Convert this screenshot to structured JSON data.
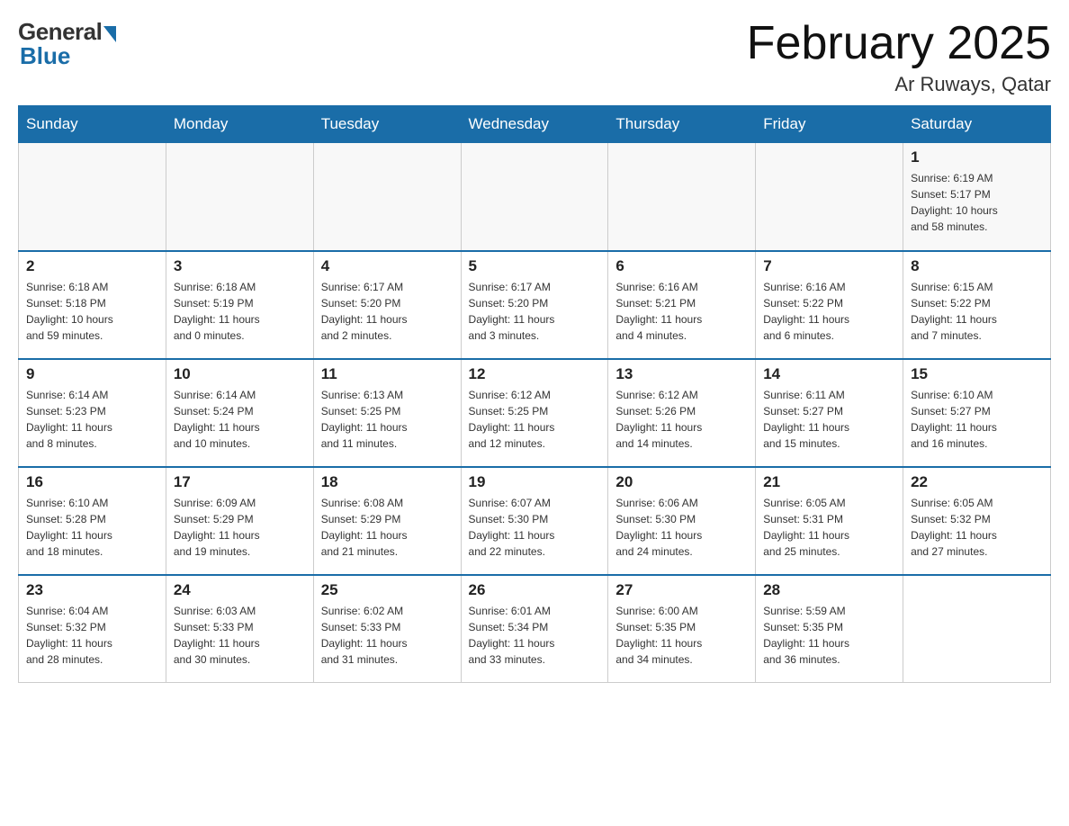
{
  "logo": {
    "general": "General",
    "blue": "Blue"
  },
  "title": "February 2025",
  "location": "Ar Ruways, Qatar",
  "days_of_week": [
    "Sunday",
    "Monday",
    "Tuesday",
    "Wednesday",
    "Thursday",
    "Friday",
    "Saturday"
  ],
  "weeks": [
    {
      "days": [
        {
          "number": "",
          "info": ""
        },
        {
          "number": "",
          "info": ""
        },
        {
          "number": "",
          "info": ""
        },
        {
          "number": "",
          "info": ""
        },
        {
          "number": "",
          "info": ""
        },
        {
          "number": "",
          "info": ""
        },
        {
          "number": "1",
          "info": "Sunrise: 6:19 AM\nSunset: 5:17 PM\nDaylight: 10 hours\nand 58 minutes."
        }
      ]
    },
    {
      "days": [
        {
          "number": "2",
          "info": "Sunrise: 6:18 AM\nSunset: 5:18 PM\nDaylight: 10 hours\nand 59 minutes."
        },
        {
          "number": "3",
          "info": "Sunrise: 6:18 AM\nSunset: 5:19 PM\nDaylight: 11 hours\nand 0 minutes."
        },
        {
          "number": "4",
          "info": "Sunrise: 6:17 AM\nSunset: 5:20 PM\nDaylight: 11 hours\nand 2 minutes."
        },
        {
          "number": "5",
          "info": "Sunrise: 6:17 AM\nSunset: 5:20 PM\nDaylight: 11 hours\nand 3 minutes."
        },
        {
          "number": "6",
          "info": "Sunrise: 6:16 AM\nSunset: 5:21 PM\nDaylight: 11 hours\nand 4 minutes."
        },
        {
          "number": "7",
          "info": "Sunrise: 6:16 AM\nSunset: 5:22 PM\nDaylight: 11 hours\nand 6 minutes."
        },
        {
          "number": "8",
          "info": "Sunrise: 6:15 AM\nSunset: 5:22 PM\nDaylight: 11 hours\nand 7 minutes."
        }
      ]
    },
    {
      "days": [
        {
          "number": "9",
          "info": "Sunrise: 6:14 AM\nSunset: 5:23 PM\nDaylight: 11 hours\nand 8 minutes."
        },
        {
          "number": "10",
          "info": "Sunrise: 6:14 AM\nSunset: 5:24 PM\nDaylight: 11 hours\nand 10 minutes."
        },
        {
          "number": "11",
          "info": "Sunrise: 6:13 AM\nSunset: 5:25 PM\nDaylight: 11 hours\nand 11 minutes."
        },
        {
          "number": "12",
          "info": "Sunrise: 6:12 AM\nSunset: 5:25 PM\nDaylight: 11 hours\nand 12 minutes."
        },
        {
          "number": "13",
          "info": "Sunrise: 6:12 AM\nSunset: 5:26 PM\nDaylight: 11 hours\nand 14 minutes."
        },
        {
          "number": "14",
          "info": "Sunrise: 6:11 AM\nSunset: 5:27 PM\nDaylight: 11 hours\nand 15 minutes."
        },
        {
          "number": "15",
          "info": "Sunrise: 6:10 AM\nSunset: 5:27 PM\nDaylight: 11 hours\nand 16 minutes."
        }
      ]
    },
    {
      "days": [
        {
          "number": "16",
          "info": "Sunrise: 6:10 AM\nSunset: 5:28 PM\nDaylight: 11 hours\nand 18 minutes."
        },
        {
          "number": "17",
          "info": "Sunrise: 6:09 AM\nSunset: 5:29 PM\nDaylight: 11 hours\nand 19 minutes."
        },
        {
          "number": "18",
          "info": "Sunrise: 6:08 AM\nSunset: 5:29 PM\nDaylight: 11 hours\nand 21 minutes."
        },
        {
          "number": "19",
          "info": "Sunrise: 6:07 AM\nSunset: 5:30 PM\nDaylight: 11 hours\nand 22 minutes."
        },
        {
          "number": "20",
          "info": "Sunrise: 6:06 AM\nSunset: 5:30 PM\nDaylight: 11 hours\nand 24 minutes."
        },
        {
          "number": "21",
          "info": "Sunrise: 6:05 AM\nSunset: 5:31 PM\nDaylight: 11 hours\nand 25 minutes."
        },
        {
          "number": "22",
          "info": "Sunrise: 6:05 AM\nSunset: 5:32 PM\nDaylight: 11 hours\nand 27 minutes."
        }
      ]
    },
    {
      "days": [
        {
          "number": "23",
          "info": "Sunrise: 6:04 AM\nSunset: 5:32 PM\nDaylight: 11 hours\nand 28 minutes."
        },
        {
          "number": "24",
          "info": "Sunrise: 6:03 AM\nSunset: 5:33 PM\nDaylight: 11 hours\nand 30 minutes."
        },
        {
          "number": "25",
          "info": "Sunrise: 6:02 AM\nSunset: 5:33 PM\nDaylight: 11 hours\nand 31 minutes."
        },
        {
          "number": "26",
          "info": "Sunrise: 6:01 AM\nSunset: 5:34 PM\nDaylight: 11 hours\nand 33 minutes."
        },
        {
          "number": "27",
          "info": "Sunrise: 6:00 AM\nSunset: 5:35 PM\nDaylight: 11 hours\nand 34 minutes."
        },
        {
          "number": "28",
          "info": "Sunrise: 5:59 AM\nSunset: 5:35 PM\nDaylight: 11 hours\nand 36 minutes."
        },
        {
          "number": "",
          "info": ""
        }
      ]
    }
  ]
}
